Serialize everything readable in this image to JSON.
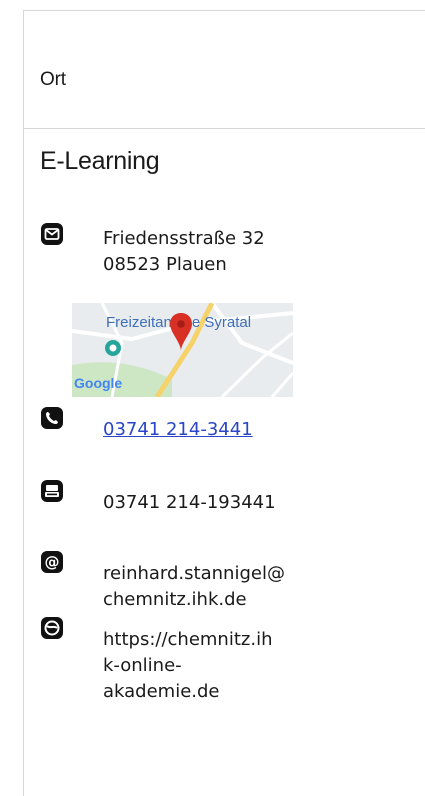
{
  "card": {
    "location_label": "Ort",
    "title": "E-Learning"
  },
  "contact": {
    "address_line1": "Friedensstraße 32",
    "address_line2": "08523 Plauen",
    "map": {
      "place_label": "Freizeitanlage Syratal",
      "brand": "Google"
    },
    "phone": "03741 214-3441",
    "fax": "03741 214-193441",
    "email_line1": "reinhard.stannigel@",
    "email_line2": "chemnitz.ihk.de",
    "website_line1": "https://chemnitz.ih",
    "website_line2": "k-online-",
    "website_line3": "akademie.de"
  },
  "icons": {
    "address": "mail-icon",
    "phone": "phone-icon",
    "fax": "fax-icon",
    "email": "at-icon",
    "website": "globe-icon"
  },
  "colors": {
    "link": "#2a46c7",
    "text": "#1a1a1a",
    "border": "#d7d7d7",
    "map_label": "#3f6fb9",
    "pin": "#d93025"
  }
}
